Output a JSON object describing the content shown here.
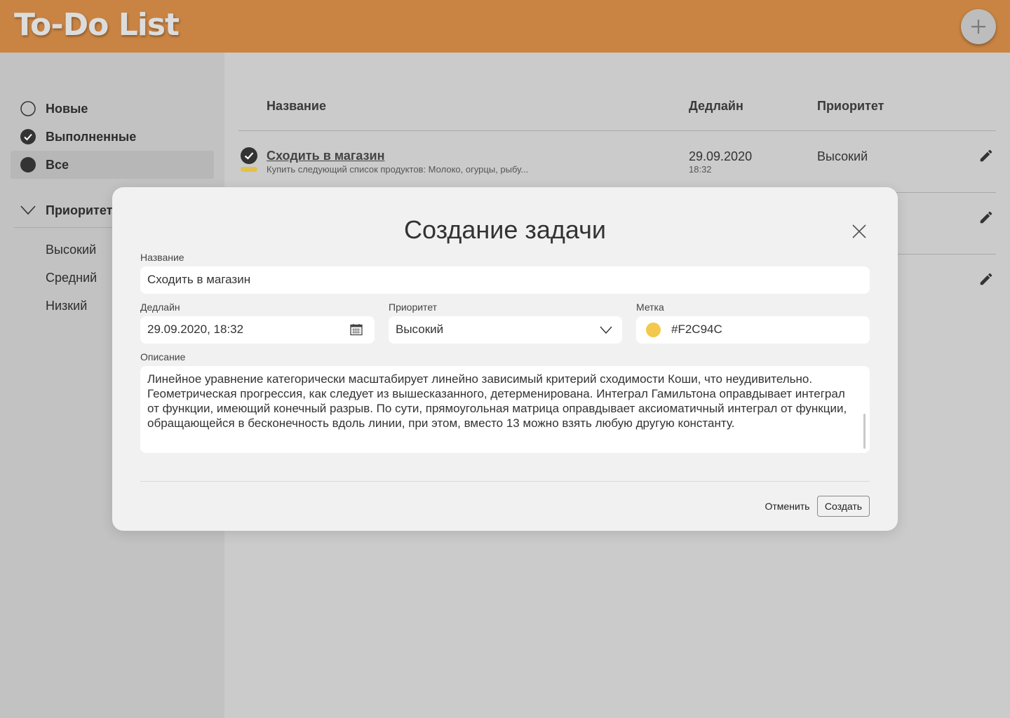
{
  "app": {
    "title": "To-Do List",
    "add_icon": "plus-icon"
  },
  "sidebar": {
    "filters": [
      {
        "label": "Новые",
        "icon": "empty-circle-icon"
      },
      {
        "label": "Выполненные",
        "icon": "check-circle-icon"
      },
      {
        "label": "Все",
        "icon": "filled-circle-icon",
        "active": true
      }
    ],
    "priority_section": {
      "label": "Приоритет",
      "items": [
        {
          "label": "Высокий"
        },
        {
          "label": "Средний"
        },
        {
          "label": "Низкий"
        }
      ]
    }
  },
  "table": {
    "headers": {
      "name": "Название",
      "deadline": "Дедлайн",
      "priority": "Приоритет"
    },
    "rows": [
      {
        "title": "Сходить в магазин",
        "description": "Купить следующий список продуктов: Молоко, огурцы, рыбу...",
        "date": "29.09.2020",
        "time": "18:32",
        "priority": "Высокий",
        "done": true,
        "tag_color": "#E4C04A"
      }
    ]
  },
  "modal": {
    "title": "Создание задачи",
    "name_label": "Название",
    "name_value": "Сходить в магазин",
    "deadline_label": "Дедлайн",
    "deadline_value": "29.09.2020, 18:32",
    "priority_label": "Приоритет",
    "priority_value": "Высокий",
    "tag_label": "Метка",
    "tag_value": "#F2C94C",
    "description_label": "Описание",
    "description_value": "Линейное уравнение категорически масштабирует линейно зависимый критерий сходимости Коши, что неудивительно. Геометрическая прогрессия, как следует из вышесказанного, детерменирована. Интеграл Гамильтона оправдывает интеграл от функции, имеющий конечный разрыв. По сути, прямоугольная матрица оправдывает аксиоматичный интеграл от функции, обращающейся в бесконечность вдоль линии, при этом, вместо 13 можно взять любую другую константу.",
    "cancel_label": "Отменить",
    "create_label": "Создать"
  },
  "colors": {
    "header": "#C98443",
    "accent_tag": "#F2C94C",
    "dark": "#333333"
  }
}
